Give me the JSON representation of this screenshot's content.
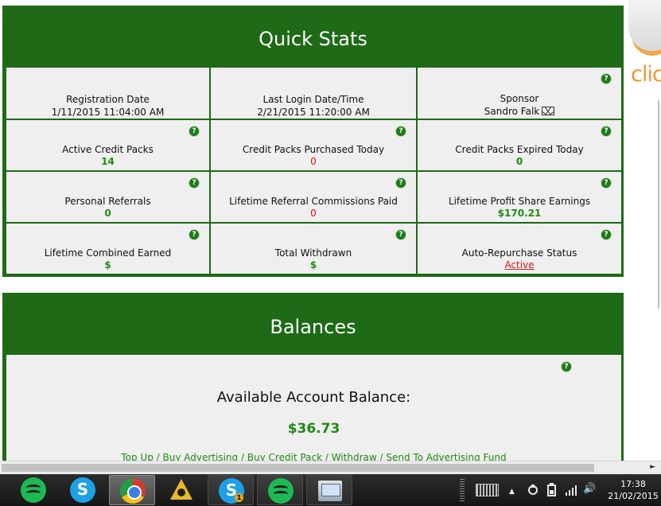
{
  "quick_stats": {
    "title": "Quick Stats",
    "cells": [
      {
        "label": "Registration Date",
        "value": "1/11/2015 11:04:00 AM"
      },
      {
        "label": "Last Login Date/Time",
        "value": "2/21/2015 11:20:00 AM"
      },
      {
        "label": "Sponsor",
        "value": "Sandro Falk"
      },
      {
        "label": "Active Credit Packs",
        "value": "14"
      },
      {
        "label": "Credit Packs Purchased Today",
        "value": "0"
      },
      {
        "label": "Credit Packs Expired Today",
        "value": "0"
      },
      {
        "label": "Personal Referrals",
        "value": "0"
      },
      {
        "label": "Lifetime Referral Commissions Paid",
        "value": "0"
      },
      {
        "label": "Lifetime Profit Share Earnings",
        "value": "$170.21"
      },
      {
        "label": "Lifetime Combined Earned",
        "value": "$"
      },
      {
        "label": "Total Withdrawn",
        "value": "$"
      },
      {
        "label": "Auto-Repurchase Status",
        "value": "Active"
      }
    ],
    "help_glyph": "?"
  },
  "balances": {
    "title": "Balances",
    "available_label": "Available Account Balance:",
    "available_amount": "$36.73",
    "actions": "Top Up / Buy Advertising / Buy Credit Pack / Withdraw / Send To Advertising Fund"
  },
  "side_logo": {
    "text": "clic"
  },
  "taskbar": {
    "apps": [
      {
        "name": "spotify-icon"
      },
      {
        "name": "skype-icon",
        "glyph": "S"
      },
      {
        "name": "chrome-icon"
      },
      {
        "name": "triangle-app-icon"
      },
      {
        "name": "skype-icon",
        "glyph": "S",
        "badge": "1"
      },
      {
        "name": "spotify-icon"
      },
      {
        "name": "monitor-app-icon"
      }
    ],
    "tray_symbols": {
      "up_arrow": "▲",
      "volume": "🔊"
    },
    "time": "17:38",
    "date": "21/02/2015"
  },
  "scrollbar": {
    "arrow": "►"
  },
  "colors": {
    "panel_green": "#1e6a16",
    "value_green": "#1f8a12",
    "value_red": "#d11a1a",
    "cell_bg": "#efefef"
  }
}
